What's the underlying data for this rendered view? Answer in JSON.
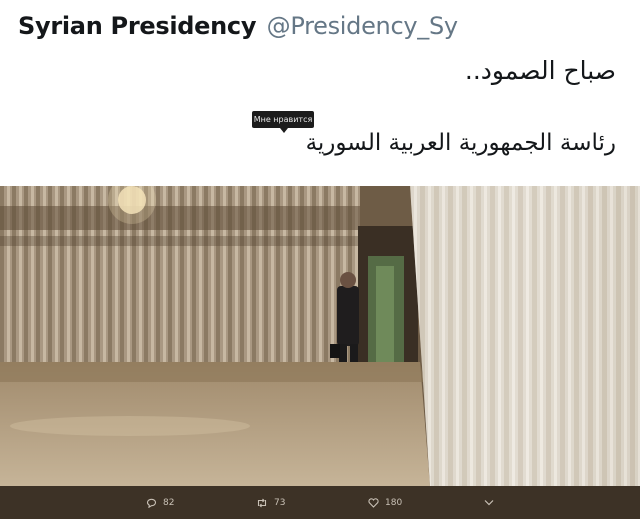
{
  "tweet": {
    "display_name": "Syrian Presidency",
    "handle": "@Presidency_Sy",
    "text_line1": "صباح الصمود..",
    "text_line2": "رئاسة الجمهورية العربية السورية",
    "tooltip": "Мне нравится"
  },
  "actions": {
    "reply_count": "82",
    "retweet_count": "73",
    "like_count": "180"
  },
  "icons": {
    "reply": "reply-icon",
    "retweet": "retweet-icon",
    "like": "heart-icon",
    "more": "chevron-down-icon"
  }
}
